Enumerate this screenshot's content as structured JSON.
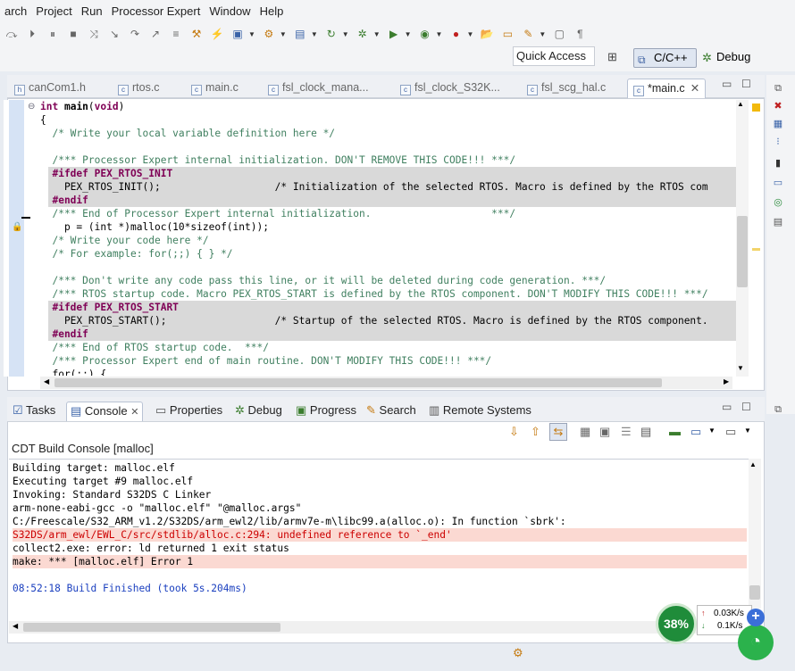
{
  "menu": [
    "arch",
    "Project",
    "Run",
    "Processor Expert",
    "Window",
    "Help"
  ],
  "quick_access": "Quick Access",
  "perspectives": {
    "cpp": "C/C++",
    "debug": "Debug"
  },
  "editor_tabs": [
    "canCom1.h",
    "rtos.c",
    "main.c",
    "fsl_clock_mana...",
    "fsl_clock_S32K...",
    "fsl_scg_hal.c",
    "*main.c"
  ],
  "code_lines": [
    "int main(void)",
    "{",
    "  /* Write your local variable definition here */",
    "",
    "  /*** Processor Expert internal initialization. DON'T REMOVE THIS CODE!!! ***/",
    "  #ifdef PEX_RTOS_INIT",
    "    PEX_RTOS_INIT();                   /* Initialization of the selected RTOS. Macro is defined by the RTOS com",
    "  #endif",
    "  /*** End of Processor Expert internal initialization.                    ***/",
    "    p = (int *)malloc(10*sizeof(int));",
    "  /* Write your code here */",
    "  /* For example: for(;;) { } */",
    "",
    "  /*** Don't write any code pass this line, or it will be deleted during code generation. ***/",
    "  /*** RTOS startup code. Macro PEX_RTOS_START is defined by the RTOS component. DON'T MODIFY THIS CODE!!! ***/",
    "  #ifdef PEX_RTOS_START",
    "    PEX_RTOS_START();                  /* Startup of the selected RTOS. Macro is defined by the RTOS component.",
    "  #endif",
    "  /*** End of RTOS startup code.  ***/",
    "  /*** Processor Expert end of main routine. DON'T MODIFY THIS CODE!!! ***/",
    "  for(;;) {"
  ],
  "bottom_tabs": [
    "Tasks",
    "Console",
    "Properties",
    "Debug",
    "Progress",
    "Search",
    "Remote Systems"
  ],
  "console_title": "CDT Build Console [malloc]",
  "console_lines": [
    "Building target: malloc.elf",
    "Executing target #9 malloc.elf",
    "Invoking: Standard S32DS C Linker",
    "arm-none-eabi-gcc -o \"malloc.elf\" \"@malloc.args\"",
    "C:/Freescale/S32_ARM_v1.2/S32DS/arm_ewl2/lib/armv7e-m\\libc99.a(alloc.o): In function `sbrk':",
    "S32DS/arm_ewl/EWL_C/src/stdlib/alloc.c:294: undefined reference to `_end'",
    "collect2.exe: error: ld returned 1 exit status",
    "make: *** [malloc.elf] Error 1",
    "",
    "08:52:18 Build Finished (took 5s.204ms)"
  ],
  "net_monitor": {
    "percent": "38%",
    "up": "0.03K/s",
    "down": "0.1K/s"
  },
  "colors": {
    "comment": "#3f7f5f",
    "keyword": "#7f0055",
    "error_bg": "#fbd9d2",
    "error_text": "#cc0000",
    "finished": "#1a3fbf"
  }
}
